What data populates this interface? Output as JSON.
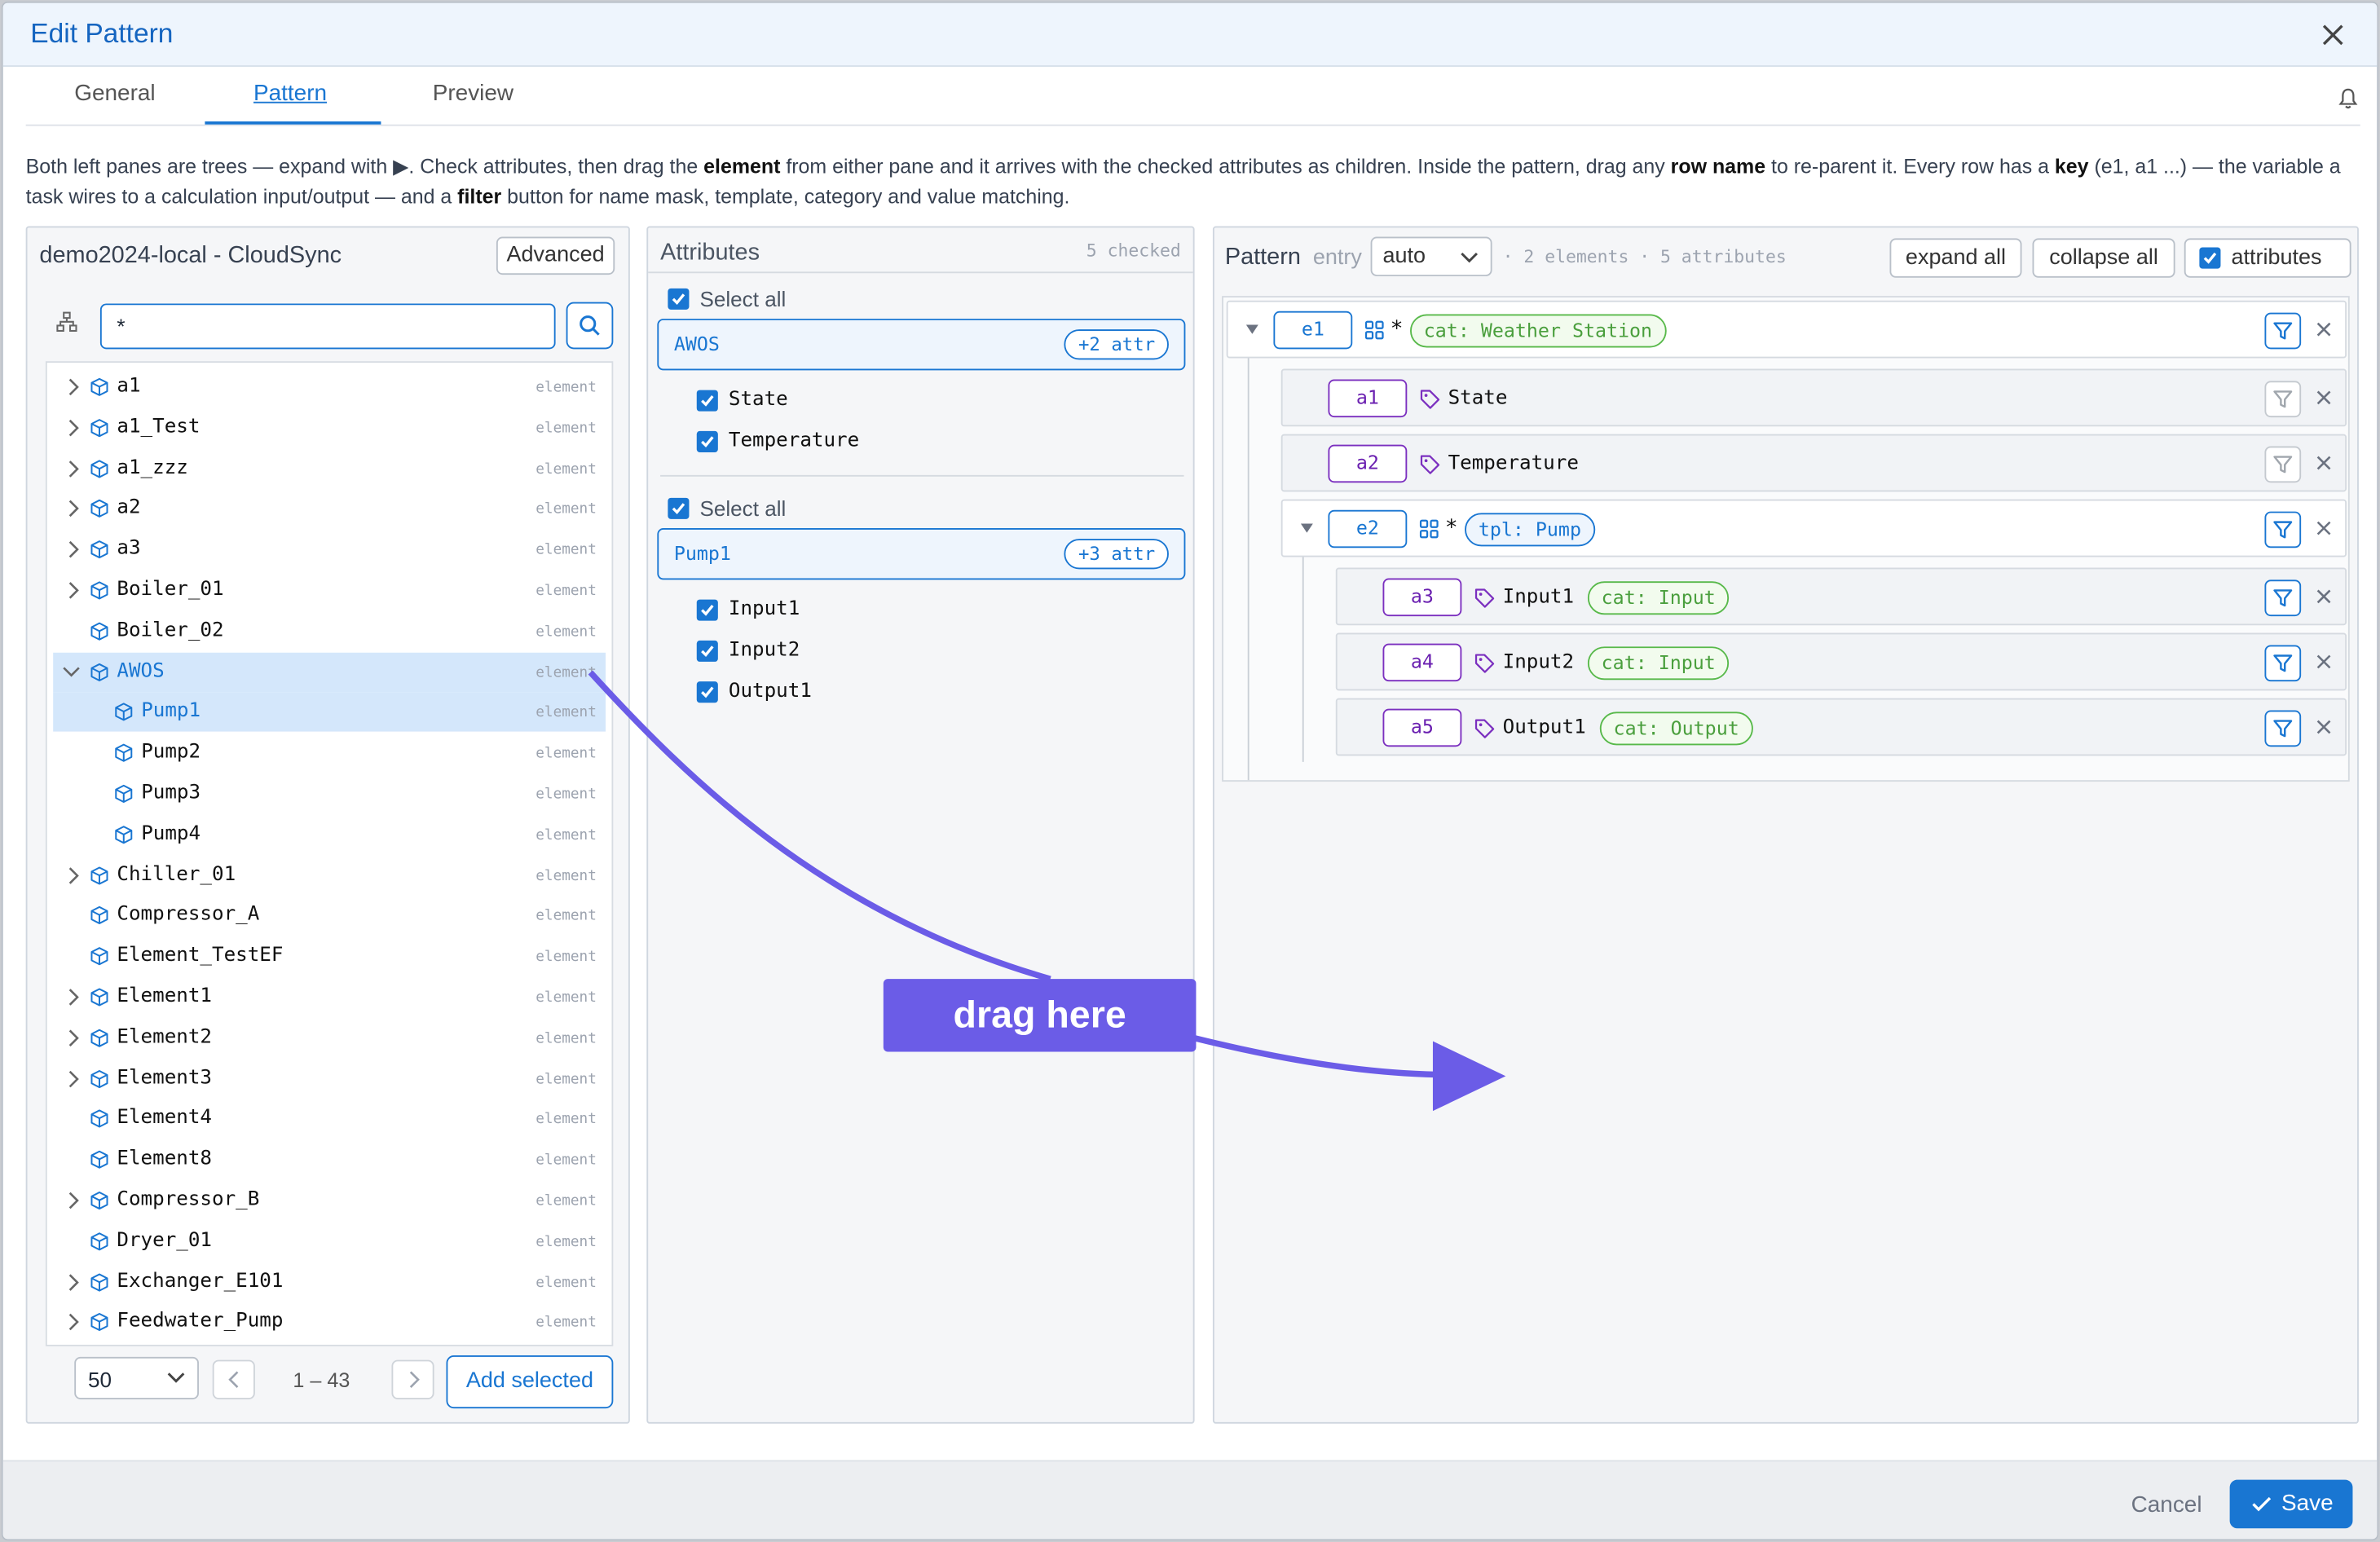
{
  "dialog": {
    "title": "Edit Pattern"
  },
  "tabs": [
    {
      "label": "General"
    },
    {
      "label": "Pattern"
    },
    {
      "label": "Preview"
    }
  ],
  "help": {
    "p1": "Both left panes are trees — expand with ▶. Check attributes, then drag the ",
    "b1": "element",
    "p2": " from either pane and it arrives with the checked attributes as children. Inside the pattern, drag any ",
    "b2": "row name",
    "p3": " to re-parent it. Every row has a ",
    "b3": "key",
    "p4": " (e1, a1 ...) — the variable a task wires to a calculation input/output — and a ",
    "b4": "filter",
    "p5": " button for name mask, template, category and value matching."
  },
  "left": {
    "title": "demo2024-local - CloudSync",
    "advanced": "Advanced",
    "search_value": "*",
    "rows": [
      {
        "label": "a1",
        "kind": "element"
      },
      {
        "label": "a1_Test",
        "kind": "element"
      },
      {
        "label": "a1_zzz",
        "kind": "element"
      },
      {
        "label": "a2",
        "kind": "element"
      },
      {
        "label": "a3",
        "kind": "element"
      },
      {
        "label": "Boiler_01",
        "kind": "element"
      },
      {
        "label": "Boiler_02",
        "kind": "element"
      },
      {
        "label": "AWOS",
        "kind": "element"
      },
      {
        "label": "Pump1",
        "kind": "element"
      },
      {
        "label": "Pump2",
        "kind": "element"
      },
      {
        "label": "Pump3",
        "kind": "element"
      },
      {
        "label": "Pump4",
        "kind": "element"
      },
      {
        "label": "Chiller_01",
        "kind": "element"
      },
      {
        "label": "Compressor_A",
        "kind": "element"
      },
      {
        "label": "Element_TestEF",
        "kind": "element"
      },
      {
        "label": "Element1",
        "kind": "element"
      },
      {
        "label": "Element2",
        "kind": "element"
      },
      {
        "label": "Element3",
        "kind": "element"
      },
      {
        "label": "Element4",
        "kind": "element"
      },
      {
        "label": "Element8",
        "kind": "element"
      },
      {
        "label": "Compressor_B",
        "kind": "element"
      },
      {
        "label": "Dryer_01",
        "kind": "element"
      },
      {
        "label": "Exchanger_E101",
        "kind": "element"
      },
      {
        "label": "Feedwater_Pump",
        "kind": "element"
      }
    ],
    "page_size": "50",
    "range": "1 – 43",
    "add_selected": "Add selected"
  },
  "attributes": {
    "title": "Attributes",
    "checked": "5 checked",
    "groups": [
      {
        "select_all": "Select all",
        "name": "AWOS",
        "badge": "+2 attr",
        "items": [
          "State",
          "Temperature"
        ]
      },
      {
        "select_all": "Select all",
        "name": "Pump1",
        "badge": "+3 attr",
        "items": [
          "Input1",
          "Input2",
          "Output1"
        ]
      }
    ]
  },
  "pattern": {
    "title": "Pattern",
    "entry_label": "entry",
    "entry_value": "auto",
    "summary": "· 2 elements · 5 attributes",
    "expand_all": "expand all",
    "collapse_all": "collapse all",
    "attributes_toggle": "attributes",
    "rows": [
      {
        "key": "e1",
        "type": "element",
        "name": "*",
        "tag": "cat: Weather Station",
        "tag_kind": "cat"
      },
      {
        "key": "a1",
        "type": "attribute",
        "name": "State"
      },
      {
        "key": "a2",
        "type": "attribute",
        "name": "Temperature"
      },
      {
        "key": "e2",
        "type": "element",
        "name": "*",
        "tag": "tpl: Pump",
        "tag_kind": "tpl"
      },
      {
        "key": "a3",
        "type": "attribute",
        "name": "Input1",
        "tag": "cat: Input",
        "tag_kind": "cat"
      },
      {
        "key": "a4",
        "type": "attribute",
        "name": "Input2",
        "tag": "cat: Input",
        "tag_kind": "cat"
      },
      {
        "key": "a5",
        "type": "attribute",
        "name": "Output1",
        "tag": "cat: Output",
        "tag_kind": "cat"
      }
    ]
  },
  "drag_hint": "drag here",
  "footer": {
    "cancel": "Cancel",
    "save": "Save"
  },
  "colors": {
    "accent": "#1976d2",
    "key_purple": "#7b2fbf",
    "tag_green": "#58b94a",
    "drag_arrow": "#6b5ce7"
  }
}
